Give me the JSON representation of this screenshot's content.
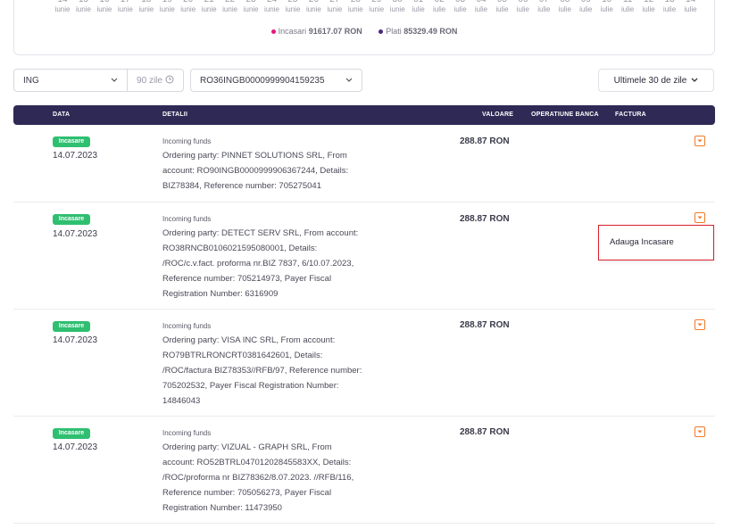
{
  "chart_strip": {
    "days": [
      {
        "num": "14",
        "month": "iunie"
      },
      {
        "num": "15",
        "month": "iunie"
      },
      {
        "num": "16",
        "month": "iunie"
      },
      {
        "num": "17",
        "month": "iunie"
      },
      {
        "num": "18",
        "month": "iunie"
      },
      {
        "num": "19",
        "month": "iunie"
      },
      {
        "num": "20",
        "month": "iunie"
      },
      {
        "num": "21",
        "month": "iunie"
      },
      {
        "num": "22",
        "month": "iunie"
      },
      {
        "num": "23",
        "month": "iunie"
      },
      {
        "num": "24",
        "month": "iunie"
      },
      {
        "num": "25",
        "month": "iunie"
      },
      {
        "num": "26",
        "month": "iunie"
      },
      {
        "num": "27",
        "month": "iunie"
      },
      {
        "num": "28",
        "month": "iunie"
      },
      {
        "num": "29",
        "month": "iunie"
      },
      {
        "num": "30",
        "month": "iunie"
      },
      {
        "num": "01",
        "month": "iulie"
      },
      {
        "num": "02",
        "month": "iulie"
      },
      {
        "num": "03",
        "month": "iulie"
      },
      {
        "num": "04",
        "month": "iulie"
      },
      {
        "num": "05",
        "month": "iulie"
      },
      {
        "num": "06",
        "month": "iulie"
      },
      {
        "num": "07",
        "month": "iulie"
      },
      {
        "num": "08",
        "month": "iulie"
      },
      {
        "num": "09",
        "month": "iulie"
      },
      {
        "num": "10",
        "month": "iulie"
      },
      {
        "num": "11",
        "month": "iulie"
      },
      {
        "num": "12",
        "month": "iulie"
      },
      {
        "num": "13",
        "month": "iulie"
      },
      {
        "num": "14",
        "month": "iulie"
      }
    ],
    "legend": {
      "incasari_label": "Incasari",
      "incasari_value": "91617.07 RON",
      "incasari_color": "#e6177a",
      "plati_label": "Plati",
      "plati_value": "85329.49 RON",
      "plati_color": "#4a2a7a"
    }
  },
  "filters": {
    "bank": "ING",
    "bank_icon": "chevron-down-icon",
    "days": "90 zile",
    "days_icon": "clock-icon",
    "iban": "RO36INGB0000999904159235",
    "period": "Ultimele 30 de zile"
  },
  "table": {
    "headers": {
      "data": "DATA",
      "detalii": "DETALII",
      "valoare": "VALOARE",
      "operatiune": "OPERATIUNE BANCA",
      "factura": "FACTURA"
    },
    "rows": [
      {
        "badge": "Incasare",
        "date": "14.07.2023",
        "title": "Incoming funds",
        "lines": [
          "Ordering party: PINNET SOLUTIONS SRL, From",
          "account: RO90INGB0000999906367244, Details:",
          "BIZ78384, Reference number: 705275041"
        ],
        "amount": "288.87 RON"
      },
      {
        "badge": "Incasare",
        "date": "14.07.2023",
        "title": "Incoming funds",
        "lines": [
          "Ordering party: DETECT SERV SRL, From account:",
          "RO38RNCB0106021595080001, Details:",
          "/ROC/c.v.fact. proforma nr.BIZ 7837, 6/10.07.2023,",
          "Reference number: 705214973, Payer Fiscal",
          "Registration Number: 6316909"
        ],
        "amount": "288.87 RON"
      },
      {
        "badge": "Incasare",
        "date": "14.07.2023",
        "title": "Incoming funds",
        "lines": [
          "Ordering party: VISA INC SRL, From account:",
          "RO79BTRLRONCRT0381642601, Details:",
          "/ROC/factura BIZ78353//RFB/97, Reference number:",
          "705202532, Payer Fiscal Registration Number:",
          "14846043"
        ],
        "amount": "288.87 RON"
      },
      {
        "badge": "Incasare",
        "date": "14.07.2023",
        "title": "Incoming funds",
        "lines": [
          "Ordering party: VIZUAL - GRAPH SRL, From",
          "account: RO52BTRL04701202845583XX, Details:",
          "/ROC/proforma nr BIZ78362/8.07.2023. //RFB/116,",
          "Reference number: 705056273, Payer Fiscal",
          "Registration Number: 11473950"
        ],
        "amount": "288.87 RON"
      }
    ]
  },
  "popup": {
    "item": "Adauga Incasare"
  }
}
